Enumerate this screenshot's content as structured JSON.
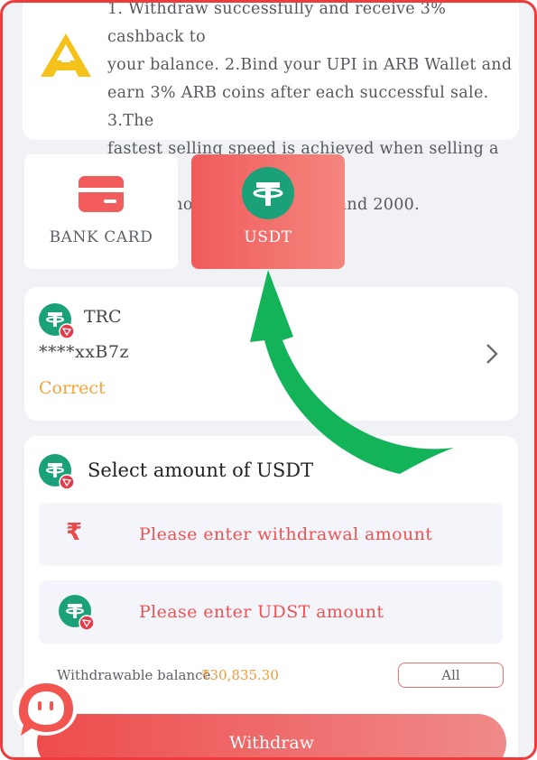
{
  "notice": {
    "lines": [
      "1. Withdraw successfully and receive 3% cashback to",
      "your balance.  2.Bind your UPI in ARB Wallet and",
      "earn 3% ARB coins after each successful sale.  3.The",
      "fastest selling speed is achieved when selling a single",
      "order amount between 100 and 2000."
    ],
    "logo_icon": "arb-logo-icon"
  },
  "methods": [
    {
      "label": "BANK CARD",
      "icon": "bank-card-icon",
      "selected": false
    },
    {
      "label": "USDT",
      "icon": "tether-icon",
      "selected": true
    }
  ],
  "address": {
    "network": "TRC",
    "masked": "****xxB7z",
    "status": "Correct",
    "icon": "tether-trc-icon"
  },
  "amount": {
    "title": "Select amount of USDT",
    "withdraw_placeholder": "Please enter withdrawal amount",
    "usdt_placeholder": "Please enter UDST amount",
    "currency_symbol": "₹",
    "balance_label": "Withdrawable balance",
    "balance_value": "₹30,835.30",
    "all_label": "All",
    "withdraw_label": "Withdraw"
  },
  "colors": {
    "accent": "#ee4c4c",
    "tether": "#26a17b",
    "warning": "#f2a43a",
    "arrow": "#13b35a"
  }
}
